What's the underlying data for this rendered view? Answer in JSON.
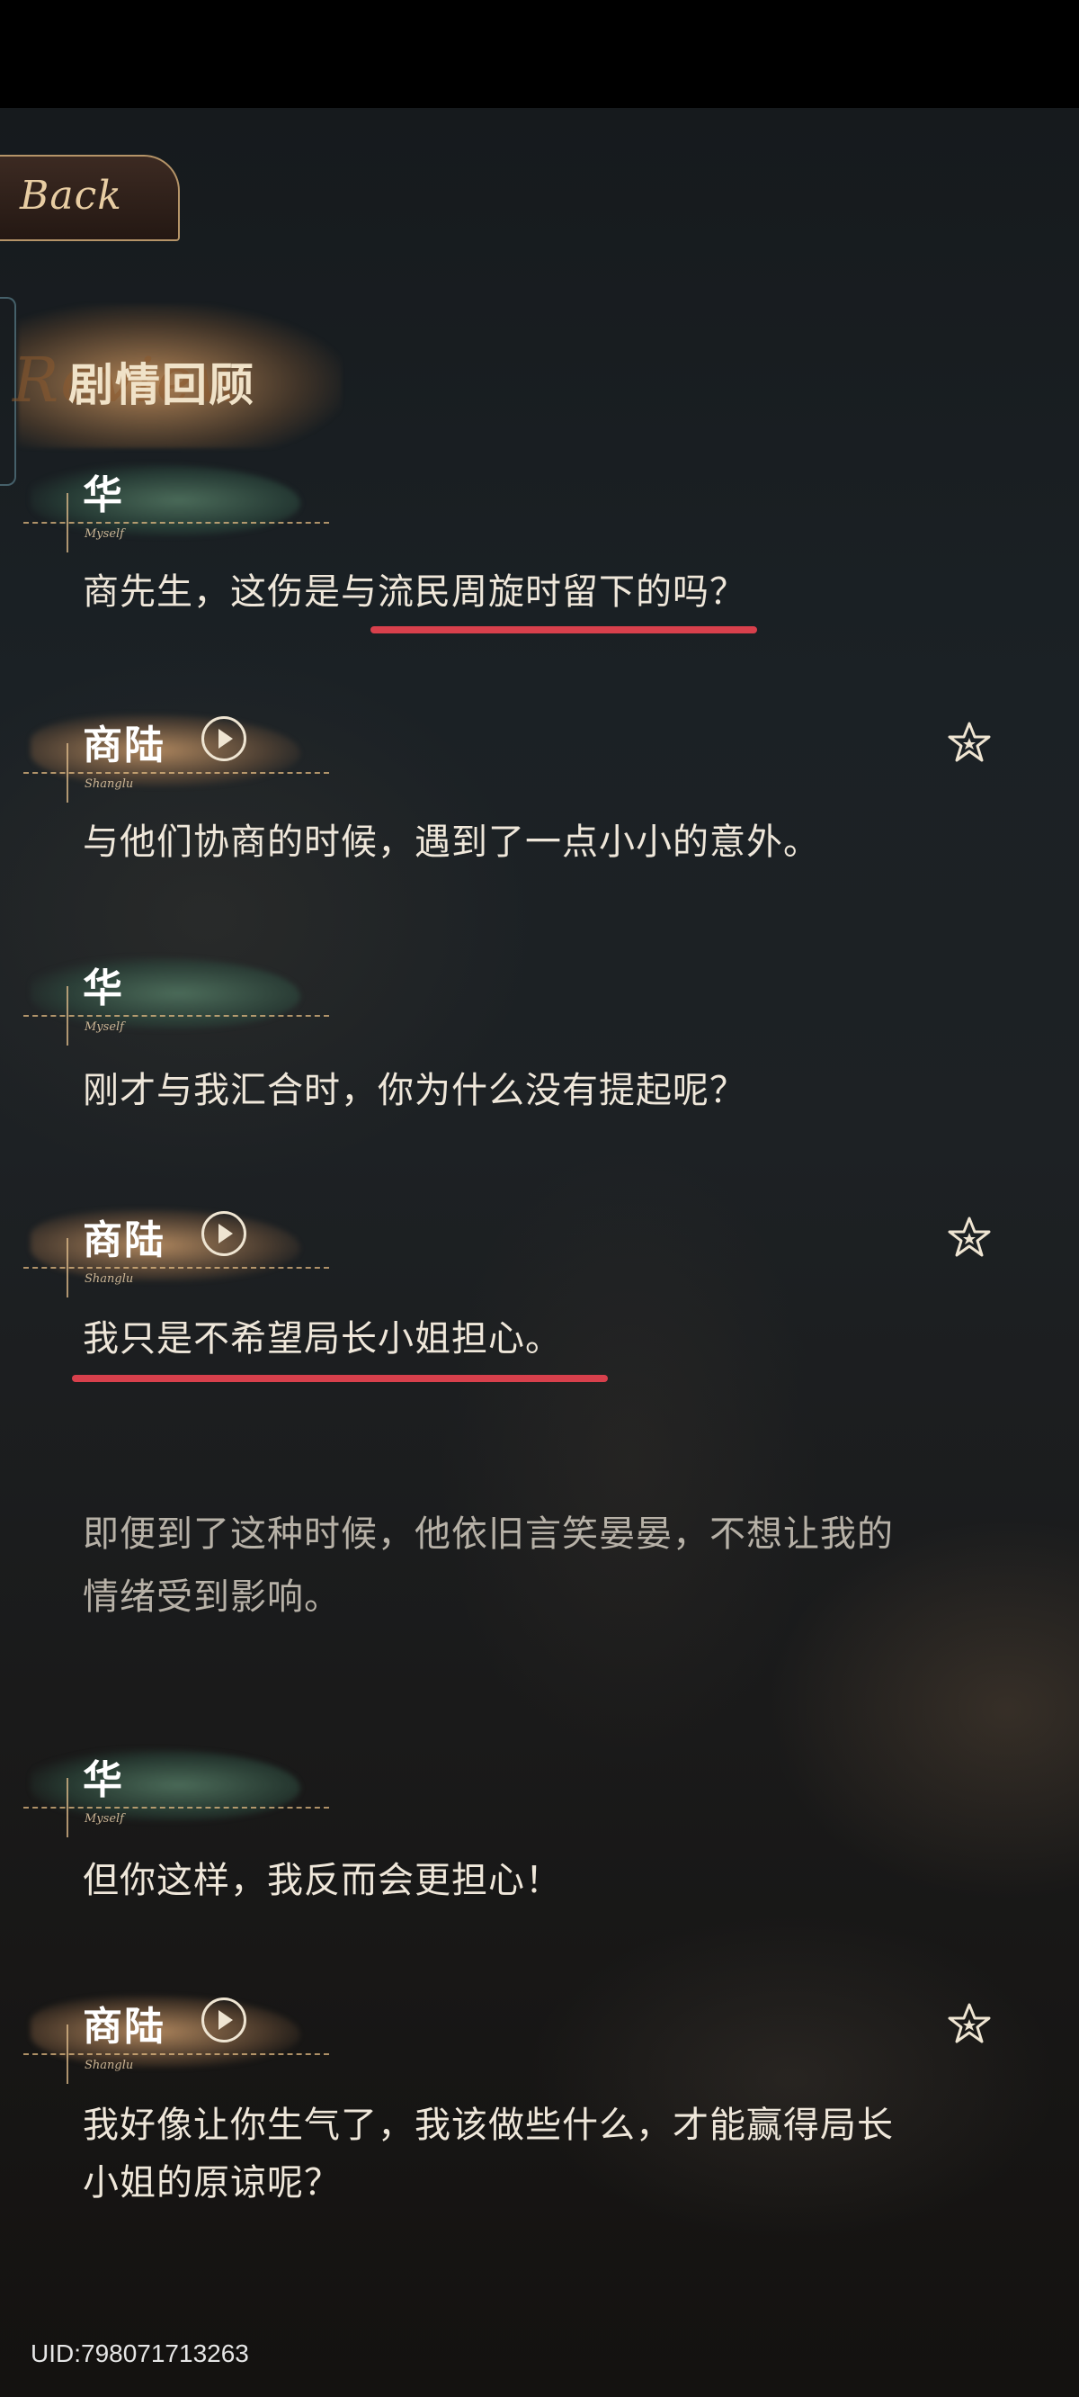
{
  "header": {
    "back_label": "Back",
    "title": "剧情回顾",
    "title_watermark": "Review"
  },
  "entries": [
    {
      "speaker": "华",
      "speaker_sub": "Myself",
      "text": "商先生，这伤是与流民周旋时留下的吗？",
      "voice": false,
      "favorite": false
    },
    {
      "speaker": "商陆",
      "speaker_sub": "Shanglu",
      "text": "与他们协商的时候，遇到了一点小小的意外。",
      "voice": true,
      "favorite": true
    },
    {
      "speaker": "华",
      "speaker_sub": "Myself",
      "text": "刚才与我汇合时，你为什么没有提起呢？",
      "voice": false,
      "favorite": false
    },
    {
      "speaker": "商陆",
      "speaker_sub": "Shanglu",
      "text": "我只是不希望局长小姐担心。",
      "voice": true,
      "favorite": true
    },
    {
      "narration_line1": "即便到了这种时候，他依旧言笑晏晏，不想让我的",
      "narration_line2": "情绪受到影响。"
    },
    {
      "speaker": "华",
      "speaker_sub": "Myself",
      "text": "但你这样，我反而会更担心！",
      "voice": false,
      "favorite": false
    },
    {
      "speaker": "商陆",
      "speaker_sub": "Shanglu",
      "text_line1": "我好像让你生气了，我该做些什么，才能赢得局长",
      "text_line2": "小姐的原谅呢？",
      "voice": true,
      "favorite": true
    }
  ],
  "footer": {
    "uid": "UID:798071713263"
  },
  "colors": {
    "underline": "#d8404c",
    "dialog_text": "#efe7da",
    "narration_text": "#b7b1a7",
    "frame_gold": "#b59468"
  },
  "icons": {
    "voice": "play-circle-icon",
    "favorite": "star-icon"
  }
}
